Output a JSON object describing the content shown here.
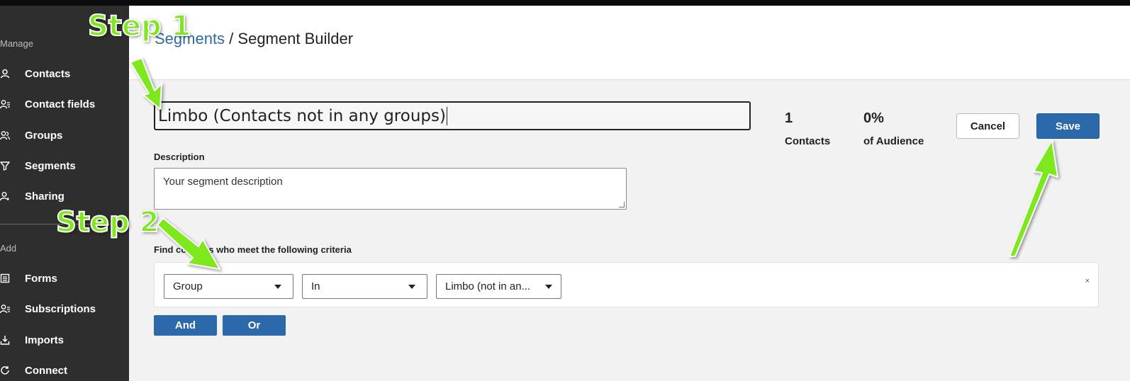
{
  "sidebar": {
    "manage_label": "Manage",
    "add_label": "Add",
    "items": [
      {
        "label": "Contacts",
        "icon": "person-icon"
      },
      {
        "label": "Contact fields",
        "icon": "person-list-icon"
      },
      {
        "label": "Groups",
        "icon": "people-icon"
      },
      {
        "label": "Segments",
        "icon": "filter-icon"
      },
      {
        "label": "Sharing",
        "icon": "person-share-icon"
      }
    ],
    "add_items": [
      {
        "label": "Forms",
        "icon": "form-icon"
      },
      {
        "label": "Subscriptions",
        "icon": "person-list-icon"
      },
      {
        "label": "Imports",
        "icon": "import-icon"
      },
      {
        "label": "Connect",
        "icon": "sync-icon"
      }
    ]
  },
  "header": {
    "breadcrumb_link": "Segments",
    "breadcrumb_sep": " / ",
    "breadcrumb_current": "Segment Builder"
  },
  "segment": {
    "name_value": "Limbo (Contacts not in any groups)",
    "description_label": "Description",
    "description_placeholder": "Your segment description"
  },
  "stats": {
    "contacts_value": "1",
    "contacts_label": "Contacts",
    "audience_value": "0%",
    "audience_label": "of Audience"
  },
  "actions": {
    "cancel_label": "Cancel",
    "save_label": "Save"
  },
  "criteria": {
    "label": "Find contacts who meet the following criteria",
    "field_value": "Group",
    "operator_value": "In",
    "target_value": "Limbo (not in an...",
    "remove_label": "×",
    "and_label": "And",
    "or_label": "Or"
  },
  "annotations": {
    "step1": "Step 1",
    "step2": "Step 2",
    "color": "#7de81f"
  }
}
